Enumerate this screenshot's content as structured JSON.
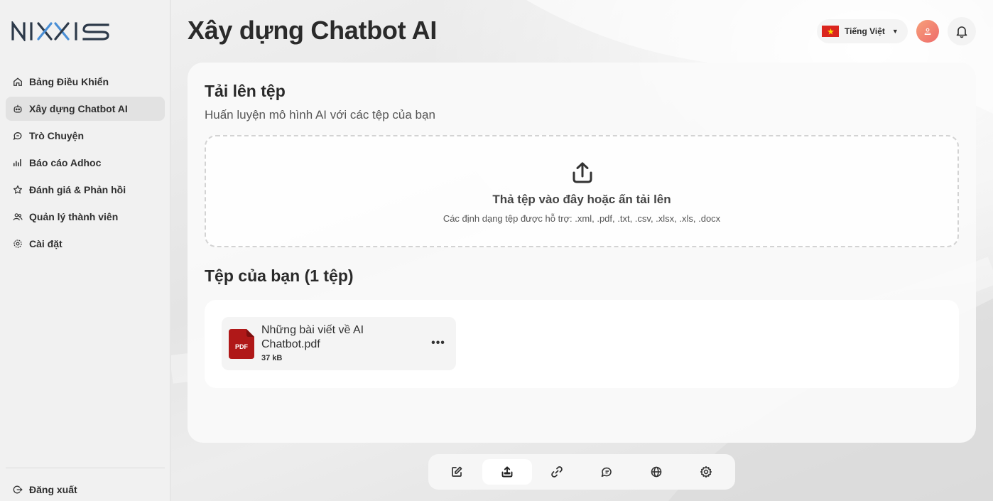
{
  "brand": {
    "logo_text": "NIXXIS"
  },
  "sidebar": {
    "items": [
      {
        "label": "Bảng Điều Khiển",
        "icon": "home-icon",
        "active": false
      },
      {
        "label": "Xây dựng Chatbot AI",
        "icon": "bot-icon",
        "active": true
      },
      {
        "label": "Trò Chuyện",
        "icon": "chat-icon",
        "active": false
      },
      {
        "label": "Báo cáo Adhoc",
        "icon": "bar-chart-icon",
        "active": false
      },
      {
        "label": "Đánh giá & Phản hồi",
        "icon": "star-icon",
        "active": false
      },
      {
        "label": "Quản lý thành viên",
        "icon": "users-icon",
        "active": false
      },
      {
        "label": "Cài đặt",
        "icon": "gear-icon",
        "active": false
      }
    ],
    "logout_label": "Đăng xuất"
  },
  "header": {
    "title": "Xây dựng Chatbot AI",
    "language": "Tiếng Việt"
  },
  "upload": {
    "title": "Tải lên tệp",
    "subtitle": "Huấn luyện mô hình AI với các tệp của bạn",
    "dropzone_title": "Thả tệp vào đây hoặc ấn tải lên",
    "dropzone_formats": "Các định dạng tệp được hỗ trợ: .xml, .pdf, .txt, .csv, .xlsx, .xls, .docx"
  },
  "files": {
    "title": "Tệp của bạn (1 tệp)",
    "items": [
      {
        "name": "Những bài viết về AI Chatbot.pdf",
        "size": "37 kB",
        "type_badge": "PDF"
      }
    ]
  },
  "toolbar": {
    "tools": [
      {
        "icon": "edit-icon",
        "active": false
      },
      {
        "icon": "upload-icon",
        "active": true
      },
      {
        "icon": "link-icon",
        "active": false
      },
      {
        "icon": "chat-bubble-icon",
        "active": false
      },
      {
        "icon": "globe-icon",
        "active": false
      },
      {
        "icon": "gear-icon",
        "active": false
      }
    ]
  },
  "colors": {
    "flag_red": "#da251d",
    "flag_star": "#ffde00",
    "pdf_red": "#b01818",
    "avatar_gradient": [
      "#f7a07a",
      "#ee6b6b"
    ]
  }
}
